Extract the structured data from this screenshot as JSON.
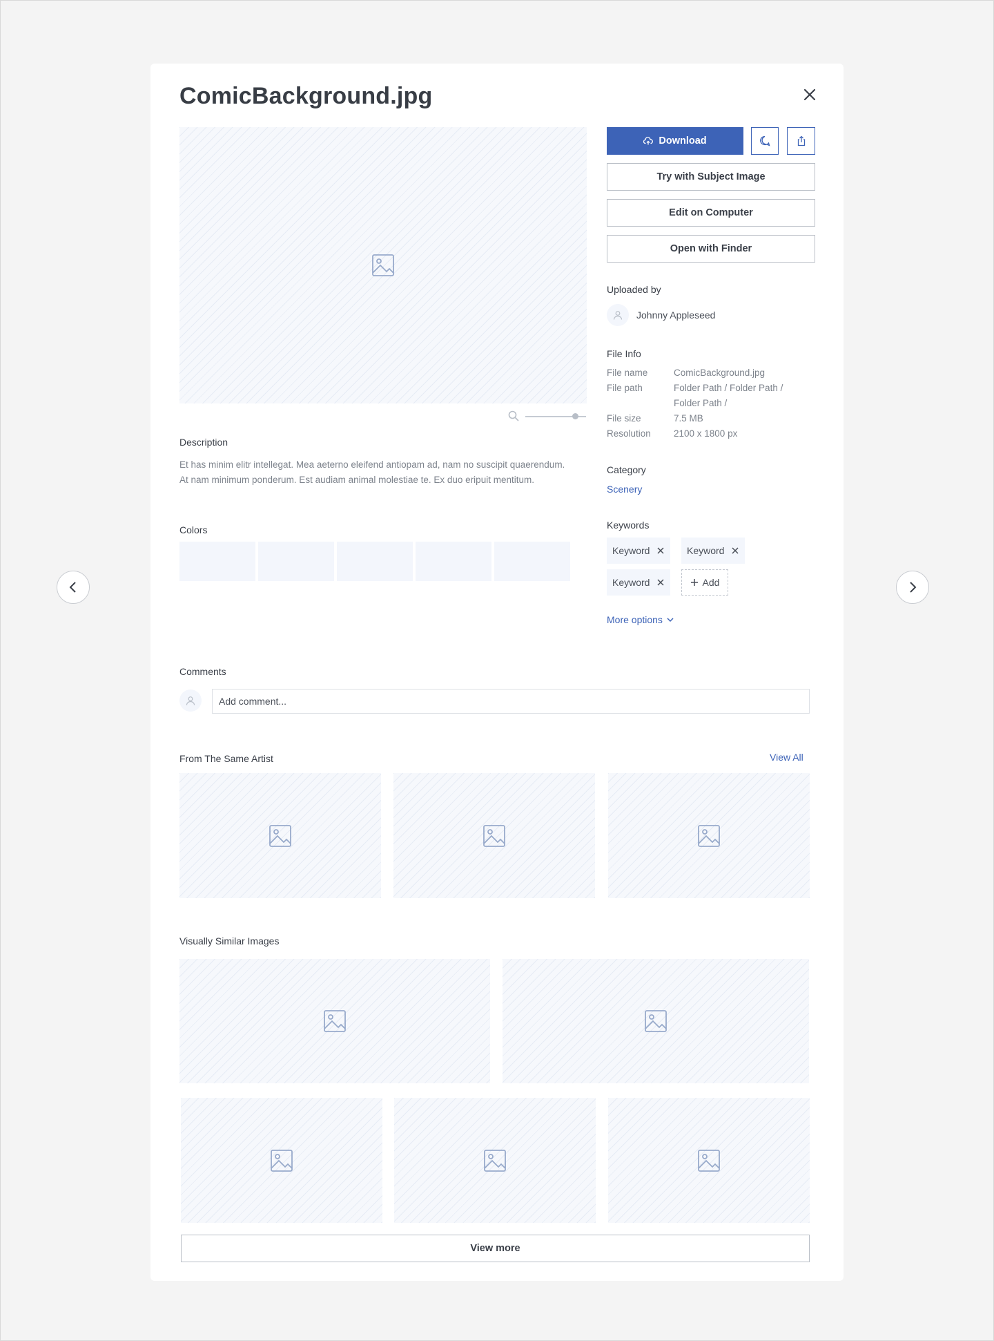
{
  "modal": {
    "title": "ComicBackground.jpg"
  },
  "actions": {
    "download_label": "Download",
    "try_subject_label": "Try with Subject Image",
    "edit_label": "Edit on Computer",
    "open_finder_label": "Open with Finder"
  },
  "description": {
    "label": "Description",
    "text": "Et has minim elitr intellegat. Mea aeterno eleifend antiopam ad, nam no suscipit quaerendum. At nam minimum ponderum. Est audiam animal molestiae te. Ex duo eripuit mentitum."
  },
  "colors": {
    "label": "Colors",
    "swatches": [
      "#f3f6fc",
      "#f3f6fc",
      "#f3f6fc",
      "#f3f6fc",
      "#f3f6fc"
    ]
  },
  "zoom": {
    "level": 0.82
  },
  "uploader": {
    "label": "Uploaded by",
    "name": "Johnny Appleseed"
  },
  "file_info": {
    "label": "File Info",
    "rows": [
      {
        "key": "File name",
        "value": "ComicBackground.jpg"
      },
      {
        "key": "File path",
        "value": "Folder Path / Folder Path / Folder Path /"
      },
      {
        "key": "File size",
        "value": "7.5 MB"
      },
      {
        "key": "Resolution",
        "value": "2100 x 1800 px"
      }
    ]
  },
  "category": {
    "label": "Category",
    "value": "Scenery"
  },
  "keywords": {
    "label": "Keywords",
    "items": [
      "Keyword",
      "Keyword",
      "Keyword"
    ],
    "add_label": "Add"
  },
  "more_options_label": "More options",
  "comments": {
    "label": "Comments",
    "placeholder": "Add comment..."
  },
  "same_artist": {
    "label": "From The Same Artist",
    "view_all_label": "View All"
  },
  "similar": {
    "label": "Visually Similar Images",
    "view_more_label": "View more"
  },
  "colors_theme": {
    "accent": "#3d63b7",
    "placeholder_bg": "#f6f8fc",
    "muted_text": "#7d838c"
  },
  "icons": {
    "close": "close-icon",
    "prev": "chevron-left-icon",
    "next": "chevron-right-icon",
    "download": "cloud-upload-icon",
    "comment": "chat-bubble-icon",
    "share": "share-icon",
    "zoom": "search-icon",
    "avatar": "user-icon",
    "image": "image-placeholder-icon"
  }
}
